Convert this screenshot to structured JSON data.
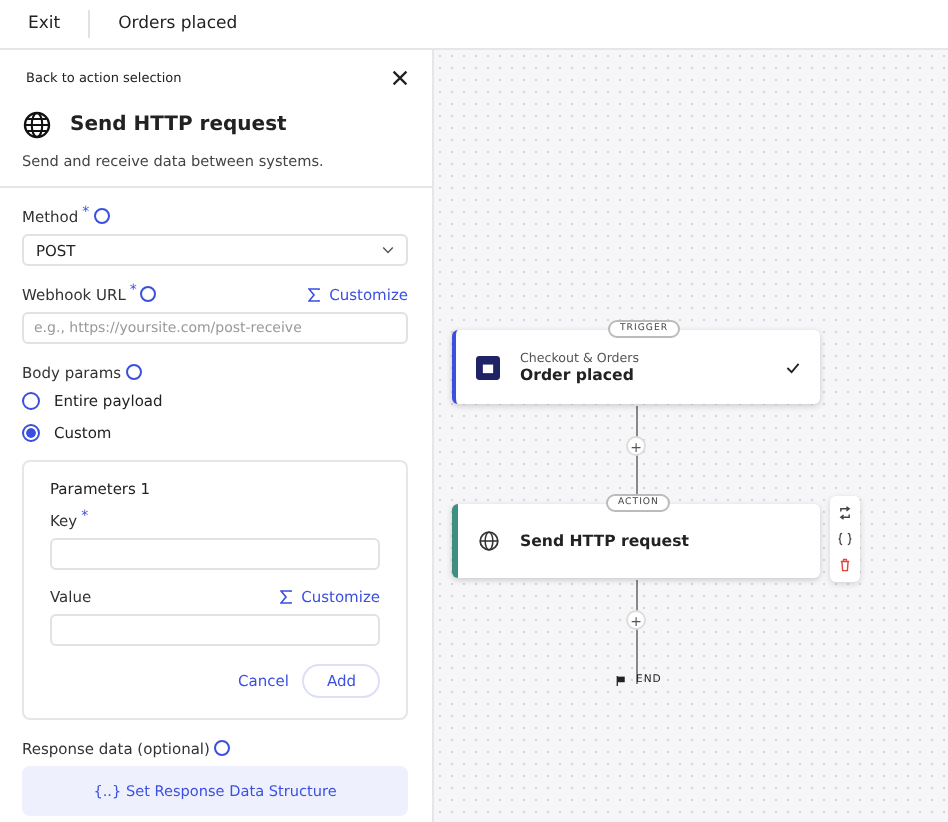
{
  "top_bar": {
    "exit": "Exit",
    "workflow_name": "Orders placed"
  },
  "panel": {
    "back": "Back to action selection",
    "title": "Send HTTP request",
    "subtitle": "Send and receive data between systems.",
    "method": {
      "label": "Method",
      "required_mark": "*",
      "value": "POST"
    },
    "webhook": {
      "label": "Webhook URL",
      "required_mark": "*",
      "customize": "Customize",
      "placeholder": "e.g., https://yoursite.com/post-receive"
    },
    "body_params": {
      "label": "Body params",
      "options": [
        {
          "label": "Entire payload",
          "selected": false
        },
        {
          "label": "Custom",
          "selected": true
        }
      ]
    },
    "parameters": {
      "title": "Parameters 1",
      "key_label": "Key",
      "key_required_mark": "*",
      "value_label": "Value",
      "customize": "Customize",
      "cancel": "Cancel",
      "add": "Add"
    },
    "response": {
      "label": "Response data (optional)",
      "button_icon": "{..}",
      "button": "Set Response Data Structure"
    }
  },
  "canvas": {
    "trigger": {
      "tag": "TRIGGER",
      "category": "Checkout & Orders",
      "title": "Order placed",
      "done": true
    },
    "action": {
      "tag": "ACTION",
      "title": "Send HTTP request"
    },
    "plus": [
      "+",
      "+"
    ],
    "end": "END"
  }
}
